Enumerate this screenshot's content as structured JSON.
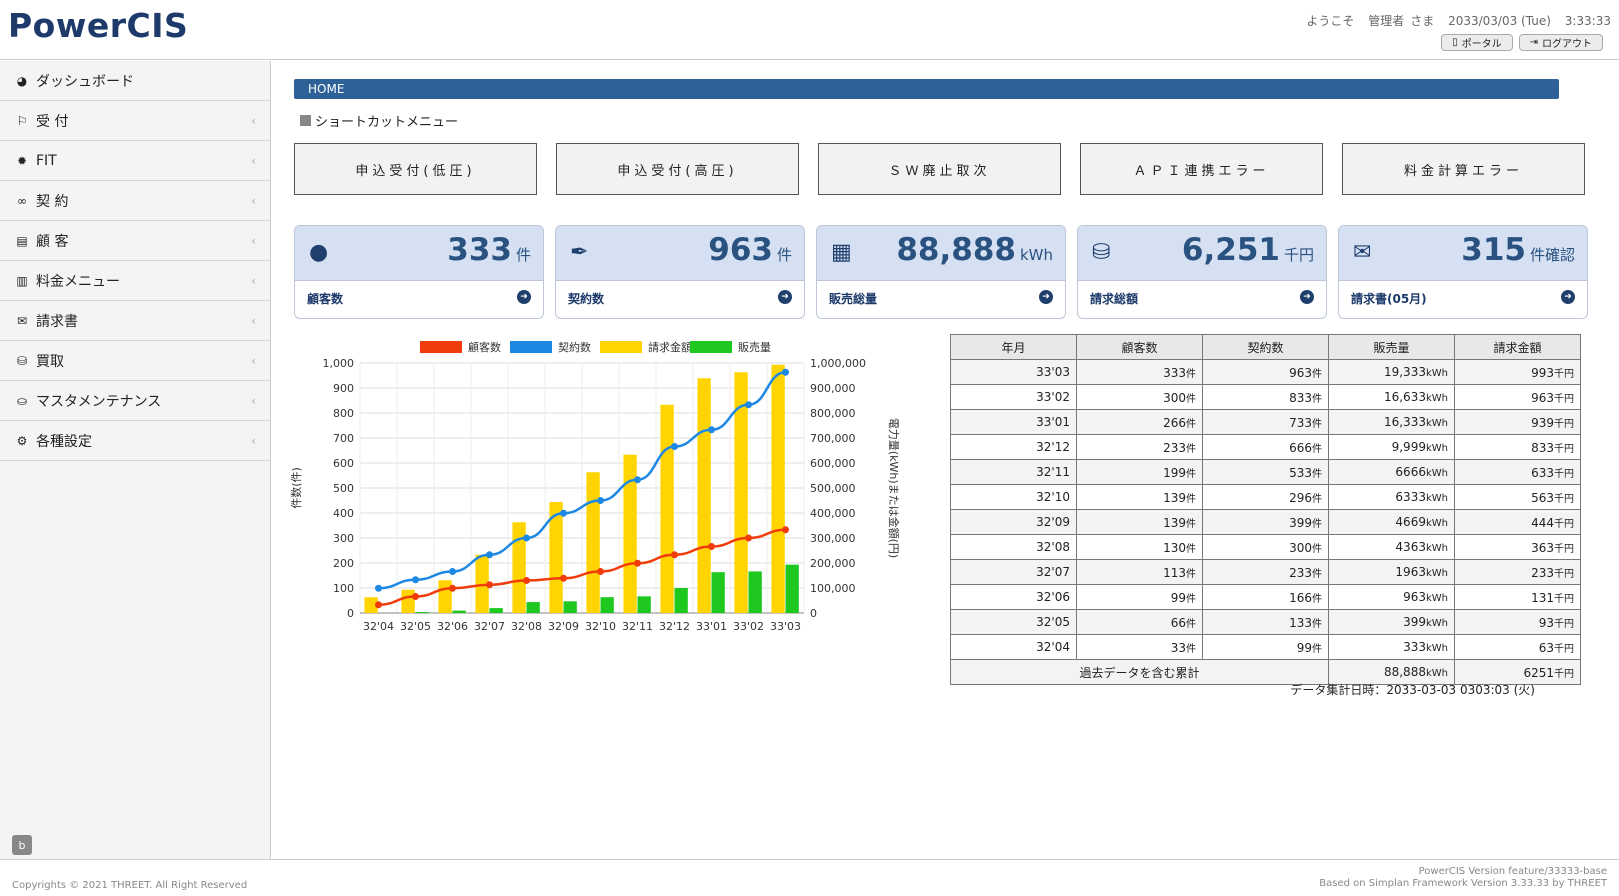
{
  "header": {
    "logo": "PowerCIS",
    "welcome": "ようこそ",
    "user": "管理者",
    "honorific": "さま",
    "datetime": "2033/03/03 (Tue)",
    "clock": "3:33:33",
    "portal_label": "ポータル",
    "logout_label": "ログアウト"
  },
  "sidebar": {
    "items": [
      {
        "label": "ダッシュボード",
        "icon": "dashboard-icon"
      },
      {
        "label": "受 付",
        "icon": "flag-icon"
      },
      {
        "label": "FIT",
        "icon": "sun-icon"
      },
      {
        "label": "契 約",
        "icon": "link-icon"
      },
      {
        "label": "顧 客",
        "icon": "file-icon"
      },
      {
        "label": "料金メニュー",
        "icon": "bar-chart-icon"
      },
      {
        "label": "請求書",
        "icon": "inbox-icon"
      },
      {
        "label": "買取",
        "icon": "coins-icon"
      },
      {
        "label": "マスタメンテナンス",
        "icon": "database-icon"
      },
      {
        "label": "各種設定",
        "icon": "gear-icon"
      }
    ],
    "footer_button": "b"
  },
  "breadcrumb": "HOME",
  "shortcut": {
    "title": "ショートカットメニュー",
    "buttons": [
      "申込受付(低圧)",
      "申込受付(高圧)",
      "ＳＷ廃止取次",
      "ＡＰＩ連携エラー",
      "料金計算エラー"
    ]
  },
  "cards": [
    {
      "value": "333",
      "unit": "件",
      "label": "顧客数",
      "icon": "user-icon"
    },
    {
      "value": "963",
      "unit": "件",
      "label": "契約数",
      "icon": "pen-icon"
    },
    {
      "value": "88,888",
      "unit": "kWh",
      "label": "販売総量",
      "icon": "cash-register-icon"
    },
    {
      "value": "6,251",
      "unit": "千円",
      "label": "請求総額",
      "icon": "coins-icon"
    },
    {
      "value": "315",
      "unit": "件確認",
      "label": "請求書(05月)",
      "icon": "envelope-icon"
    }
  ],
  "chart_data": {
    "type": "bar",
    "categories": [
      "32'04",
      "32'05",
      "32'06",
      "32'07",
      "32'08",
      "32'09",
      "32'10",
      "32'11",
      "32'12",
      "33'01",
      "33'02",
      "33'03"
    ],
    "series": [
      {
        "name": "顧客数",
        "type": "line",
        "axis": "left",
        "color": "#f03c0a",
        "values": [
          33,
          66,
          99,
          113,
          130,
          139,
          166,
          199,
          233,
          266,
          300,
          333
        ]
      },
      {
        "name": "契約数",
        "type": "line",
        "axis": "left",
        "color": "#1e88e5",
        "values": [
          99,
          133,
          166,
          233,
          300,
          399,
          450,
          533,
          666,
          733,
          833,
          963
        ]
      },
      {
        "name": "請求金額",
        "type": "bar",
        "axis": "right",
        "color": "#ffd400",
        "values": [
          63000,
          93000,
          131000,
          233000,
          363000,
          444000,
          563000,
          633000,
          833000,
          939000,
          963000,
          993000
        ]
      },
      {
        "name": "販売量",
        "type": "bar",
        "axis": "right",
        "color": "#1ec81e",
        "values": [
          333,
          3990,
          9630,
          19630,
          43630,
          46690,
          63330,
          66660,
          99990,
          163330,
          166330,
          193330
        ]
      }
    ],
    "ylabel": "件数(件)",
    "y2label": "電力量(kWh)または金額(円)",
    "ylim": [
      0,
      1000
    ],
    "y2lim": [
      0,
      1000000
    ],
    "yticks": [
      "0",
      "100",
      "200",
      "300",
      "400",
      "500",
      "600",
      "700",
      "800",
      "900",
      "1,000"
    ],
    "y2ticks": [
      "0",
      "100,000",
      "200,000",
      "300,000",
      "400,000",
      "500,000",
      "600,000",
      "700,000",
      "800,000",
      "900,000",
      "1,000,000"
    ],
    "grid": true,
    "legend": "top"
  },
  "table": {
    "headers": [
      "年月",
      "顧客数",
      "契約数",
      "販売量",
      "請求金額"
    ],
    "units": {
      "customers": "件",
      "contracts": "件",
      "sales": "kWh",
      "billing": "千円"
    },
    "rows": [
      {
        "ym": "33'03",
        "customers": "333",
        "contracts": "963",
        "sales": "19,333",
        "billing": "993"
      },
      {
        "ym": "33'02",
        "customers": "300",
        "contracts": "833",
        "sales": "16,633",
        "billing": "963"
      },
      {
        "ym": "33'01",
        "customers": "266",
        "contracts": "733",
        "sales": "16,333",
        "billing": "939"
      },
      {
        "ym": "32'12",
        "customers": "233",
        "contracts": "666",
        "sales": "9,999",
        "billing": "833"
      },
      {
        "ym": "32'11",
        "customers": "199",
        "contracts": "533",
        "sales": "6666",
        "billing": "633"
      },
      {
        "ym": "32'10",
        "customers": "139",
        "contracts": "296",
        "sales": "6333",
        "billing": "563"
      },
      {
        "ym": "32'09",
        "customers": "139",
        "contracts": "399",
        "sales": "4669",
        "billing": "444"
      },
      {
        "ym": "32'08",
        "customers": "130",
        "contracts": "300",
        "sales": "4363",
        "billing": "363"
      },
      {
        "ym": "32'07",
        "customers": "113",
        "contracts": "233",
        "sales": "1963",
        "billing": "233"
      },
      {
        "ym": "32'06",
        "customers": "99",
        "contracts": "166",
        "sales": "963",
        "billing": "131"
      },
      {
        "ym": "32'05",
        "customers": "66",
        "contracts": "133",
        "sales": "399",
        "billing": "93"
      },
      {
        "ym": "32'04",
        "customers": "33",
        "contracts": "99",
        "sales": "333",
        "billing": "63"
      }
    ],
    "total_label": "過去データを含む累計",
    "total_sales": "88,888",
    "total_billing": "6251"
  },
  "aggregation": "データ集計日時：2033-03-03 0303:03 (火)",
  "footer": {
    "copyright": "Copyrights © 2021 THREET. All Right Reserved",
    "version": "PowerCIS Version feature/33333-base",
    "framework": "Based on Simplan Framework Version 3.33.33 by THREET"
  }
}
